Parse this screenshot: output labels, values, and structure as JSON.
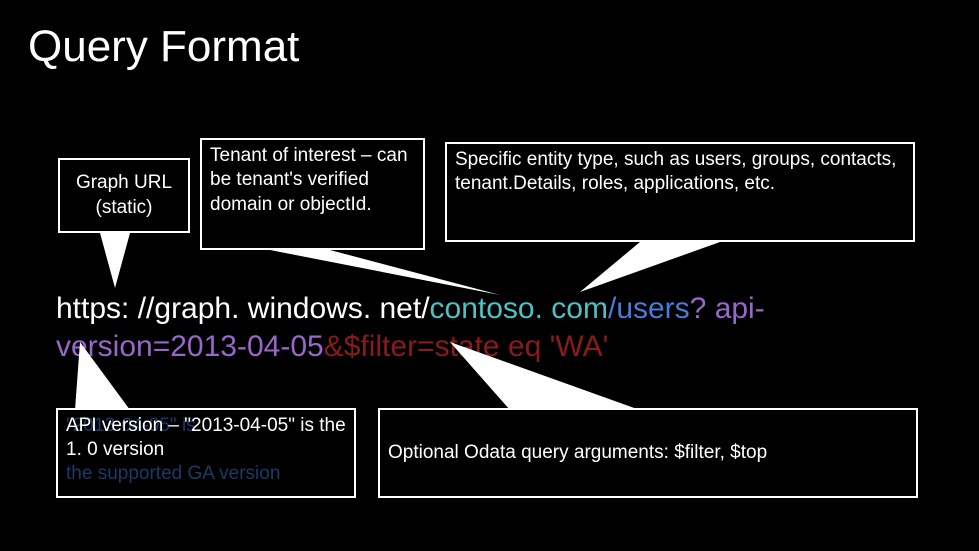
{
  "title": "Query Format",
  "boxes": {
    "graph": {
      "line1": "Graph URL",
      "line2": "(static)"
    },
    "tenant": "Tenant of interest – can be tenant's verified domain or objectId.",
    "entity": "Specific entity type, such as users, groups, contacts, tenant.Details, roles, applications, etc.",
    "api": "API version – \"2013-04-05\" is the 1. 0 version",
    "api_ghost1": "\"2013-04-05\" is",
    "api_ghost2": "the supported GA version",
    "odata": "Optional Odata query arguments: $filter, $top"
  },
  "url": {
    "p1": "https: //graph. windows. net/",
    "p2": "contoso. com",
    "p3": "/",
    "p4": "users",
    "p5": "? api-",
    "p6": "version=2013-04-05",
    "p7": "&$filter=state eq 'WA'"
  }
}
